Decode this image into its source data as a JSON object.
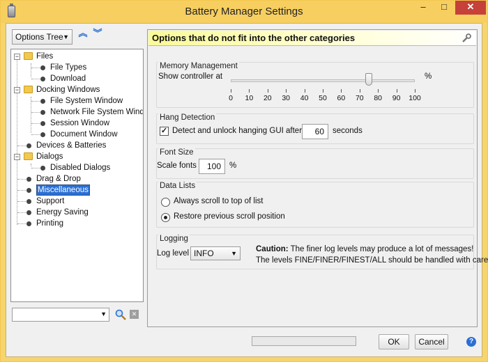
{
  "window": {
    "title": "Battery Manager Settings",
    "minimize_glyph": "–",
    "maximize_glyph": "□",
    "close_glyph": "✕"
  },
  "left": {
    "tree_mode": "Options Tree",
    "tree": [
      {
        "label": "Files",
        "icon": "folder-icon",
        "expander": "−"
      },
      {
        "label": "File Types",
        "icon": "bullet-icon"
      },
      {
        "label": "Download",
        "icon": "bullet-icon"
      },
      {
        "label": "Docking Windows",
        "icon": "folder-icon",
        "expander": "−"
      },
      {
        "label": "File System Window",
        "icon": "bullet-icon"
      },
      {
        "label": "Network File System Windo",
        "icon": "bullet-icon"
      },
      {
        "label": "Session Window",
        "icon": "bullet-icon"
      },
      {
        "label": "Document Window",
        "icon": "bullet-icon"
      },
      {
        "label": "Devices & Batteries",
        "icon": "bullet-icon"
      },
      {
        "label": "Dialogs",
        "icon": "folder-icon",
        "expander": "−"
      },
      {
        "label": "Disabled Dialogs",
        "icon": "bullet-icon"
      },
      {
        "label": "Drag & Drop",
        "icon": "bullet-icon"
      },
      {
        "label": "Miscellaneous",
        "icon": "bullet-icon",
        "selected": true
      },
      {
        "label": "Support",
        "icon": "bullet-icon"
      },
      {
        "label": "Energy Saving",
        "icon": "bullet-icon"
      },
      {
        "label": "Printing",
        "icon": "bullet-icon"
      }
    ],
    "filter_value": ""
  },
  "panel": {
    "header": "Options that do not fit into the other categories",
    "memory": {
      "title": "Memory Management",
      "label": "Show controller at",
      "unit": "%",
      "value": 75,
      "ticks": [
        "0",
        "10",
        "20",
        "30",
        "40",
        "50",
        "60",
        "70",
        "80",
        "90",
        "100"
      ]
    },
    "hang": {
      "title": "Hang Detection",
      "checkbox_label": "Detect and unlock hanging GUI after",
      "checked": true,
      "seconds_value": "60",
      "seconds_label": "seconds"
    },
    "font": {
      "title": "Font Size",
      "label": "Scale fonts",
      "value": "100",
      "unit": "%"
    },
    "datalists": {
      "title": "Data Lists",
      "option1": "Always scroll to top of list",
      "option2": "Restore previous scroll position",
      "selected": 2
    },
    "logging": {
      "title": "Logging",
      "label": "Log level",
      "value": "INFO",
      "caution_bold": "Caution:",
      "caution_text": " The finer log levels may produce a lot of messages!",
      "caution_line2": "The levels FINE/FINER/FINEST/ALL should be handled with care."
    }
  },
  "footer": {
    "ok": "OK",
    "cancel": "Cancel",
    "help_glyph": "?",
    "progress": 0
  },
  "colors": {
    "title_bar": "#f7cf60",
    "header_bg": "#fafa98",
    "selection": "#2a6fd4"
  }
}
